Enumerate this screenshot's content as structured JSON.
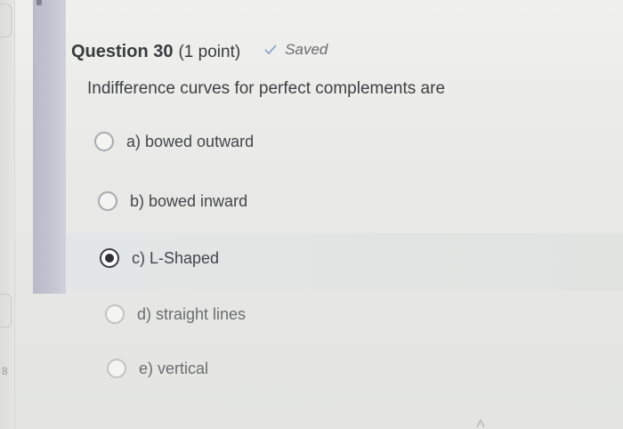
{
  "question": {
    "title": "Question 30",
    "points": "(1 point)",
    "status": "Saved",
    "status_icon": "check-icon",
    "prompt": "Indifference curves for perfect complements are"
  },
  "options": [
    {
      "label": "a) bowed outward",
      "selected": false
    },
    {
      "label": "b) bowed inward",
      "selected": false
    },
    {
      "label": "c) L-Shaped",
      "selected": true
    },
    {
      "label": "d) straight lines",
      "selected": false
    },
    {
      "label": "e) vertical",
      "selected": false
    }
  ],
  "margin": {
    "number": "8"
  },
  "colors": {
    "accent": "#c3c6d1",
    "selected_bg": "#e1e5e3",
    "text": "#3e3f42",
    "check": "#8fa7c9"
  }
}
